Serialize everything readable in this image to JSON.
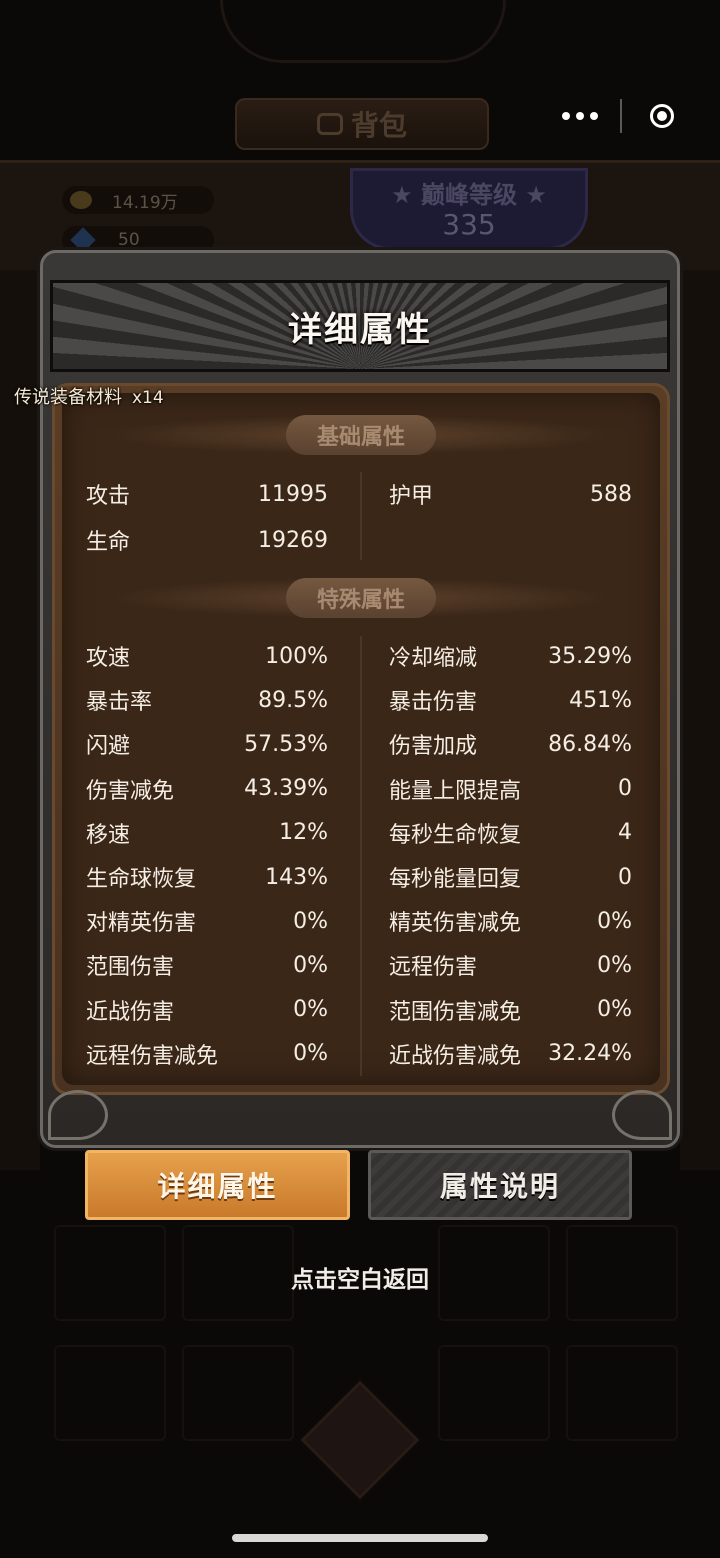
{
  "background": {
    "bag_title": "背包",
    "gold": "14.19万",
    "gems": "50",
    "peak_label": "巅峰等级",
    "peak_level": "335"
  },
  "dialog": {
    "title": "详细属性",
    "material_label": "传说装备材料",
    "material_qty": "x14",
    "basic_section": "基础属性",
    "special_section": "特殊属性",
    "basic_left": [
      {
        "label": "攻击",
        "value": "11995"
      },
      {
        "label": "生命",
        "value": "19269"
      }
    ],
    "basic_right": [
      {
        "label": "护甲",
        "value": "588"
      }
    ],
    "special_left": [
      {
        "label": "攻速",
        "value": "100%"
      },
      {
        "label": "暴击率",
        "value": "89.5%"
      },
      {
        "label": "闪避",
        "value": "57.53%"
      },
      {
        "label": "伤害减免",
        "value": "43.39%"
      },
      {
        "label": "移速",
        "value": "12%"
      },
      {
        "label": "生命球恢复",
        "value": "143%"
      },
      {
        "label": "对精英伤害",
        "value": "0%"
      },
      {
        "label": "范围伤害",
        "value": "0%"
      },
      {
        "label": "近战伤害",
        "value": "0%"
      },
      {
        "label": "远程伤害减免",
        "value": "0%"
      }
    ],
    "special_right": [
      {
        "label": "冷却缩减",
        "value": "35.29%"
      },
      {
        "label": "暴击伤害",
        "value": "451%"
      },
      {
        "label": "伤害加成",
        "value": "86.84%"
      },
      {
        "label": "能量上限提高",
        "value": "0"
      },
      {
        "label": "每秒生命恢复",
        "value": "4"
      },
      {
        "label": "每秒能量回复",
        "value": "0"
      },
      {
        "label": "精英伤害减免",
        "value": "0%"
      },
      {
        "label": "远程伤害",
        "value": "0%"
      },
      {
        "label": "范围伤害减免",
        "value": "0%"
      },
      {
        "label": "近战伤害减免",
        "value": "32.24%"
      }
    ]
  },
  "tabs": {
    "detail": "详细属性",
    "explain": "属性说明"
  },
  "return_hint": "点击空白返回",
  "colors": {
    "tab_active": "#d98c36",
    "panel_bg": "#3b2718",
    "page_bg": "#0b0908"
  }
}
